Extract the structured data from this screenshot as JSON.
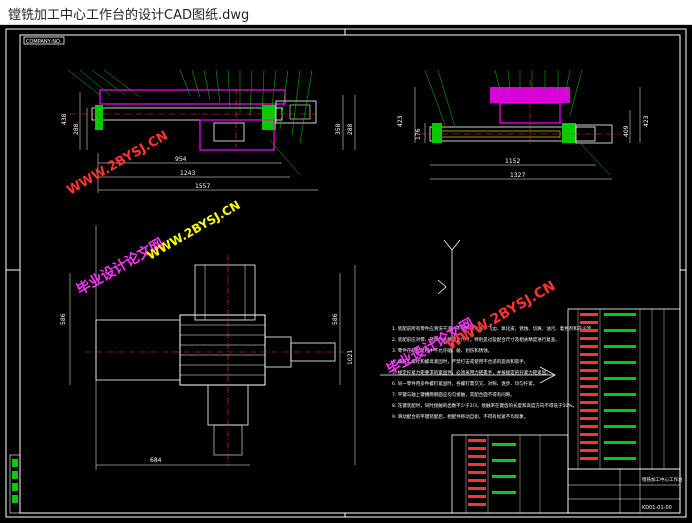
{
  "window": {
    "title": "镗铣加工中心工作台的设计CAD图纸.dwg"
  },
  "drawing": {
    "frame_label": "COMPANY·NO·",
    "watermarks": [
      {
        "text": "WWW.2BYSJ.CN"
      },
      {
        "text": "毕业设计论文网"
      },
      {
        "text": "WWW.2BYSJ.CN"
      },
      {
        "text": "毕业设计论文网"
      },
      {
        "text": "WWW.2BYSJ.CN"
      }
    ],
    "dims_front": {
      "d1": "954",
      "d2": "1243",
      "d3": "1557",
      "left_a": "438",
      "left_b": "288",
      "right_a": "358",
      "right_b": "288",
      "right_c": "358"
    },
    "dims_side": {
      "d1": "1152",
      "d2": "1327",
      "left_a": "423",
      "left_b": "176",
      "right_a": "409",
      "right_b": "423",
      "right_c": "178"
    },
    "dims_top": {
      "left": "586",
      "right_a": "586",
      "right_b": "1021",
      "bottom": "684"
    },
    "tech_notes": [
      "1. 装配前所有零件应清洗干净，不允许有毛刺、飞边、氧化皮、锈蚀、切屑、油污、着色剂和灰尘等。",
      "2. 装配前应对零、部件的主要配合尺寸，特别是过盈配合尺寸及相关精度进行复查。",
      "3. 零件在装配过程中不允许磕、碰、划伤和锈蚀。",
      "4. 螺钉、螺栓和螺母紧固时，严禁打击或使用不合适的旋具和扳手。",
      "5. 规定拧紧力矩要求的紧固件，必须采用力矩扳手，并按规定的拧紧力矩紧固。",
      "6. 同一零件用多件螺钉紧固时，各螺钉需交叉、对称、逐步、均匀拧紧。",
      "7. 平键与轴上键槽两侧面应均匀接触，其配合面不得有间隙。",
      "8. 花键装配时，同时接触的齿数不少于2/3，接触率在键齿的长度和高度方向不得低于50%。",
      "9. 滑动配合的平键装配后，相配件移动自如，不得有松紧不均现象。"
    ],
    "title_block": {
      "drawing_name": "镗铣加工中心工作台",
      "code": "KD01-01-00"
    }
  }
}
